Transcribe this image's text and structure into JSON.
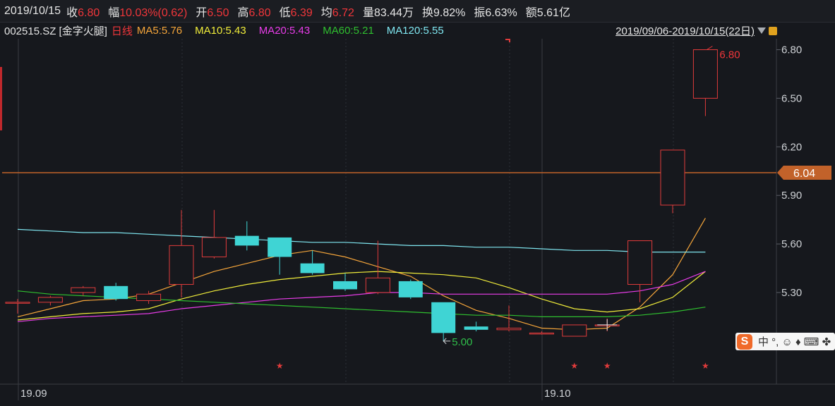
{
  "header": {
    "date": "2019/10/15",
    "fields": [
      {
        "label": "收",
        "value": "6.80",
        "color": "#f0363a"
      },
      {
        "label": "幅",
        "value": "10.03%(0.62)",
        "color": "#f0363a"
      },
      {
        "label": "开",
        "value": "6.50",
        "color": "#f0363a"
      },
      {
        "label": "高",
        "value": "6.80",
        "color": "#f0363a"
      },
      {
        "label": "低",
        "value": "6.39",
        "color": "#f0363a"
      },
      {
        "label": "均",
        "value": "6.72",
        "color": "#f0363a"
      },
      {
        "label": "量",
        "value": "83.44万",
        "color": "#e6e6e6"
      },
      {
        "label": "换",
        "value": "9.82%",
        "color": "#e6e6e6"
      },
      {
        "label": "振",
        "value": "6.63%",
        "color": "#e6e6e6"
      },
      {
        "label": "额",
        "value": "5.61亿",
        "color": "#e6e6e6"
      }
    ]
  },
  "legend": {
    "code": "002515.SZ [金字火腿]",
    "period": "日线",
    "items": [
      {
        "text": "MA5:5.76",
        "color": "#f5a53a"
      },
      {
        "text": "MA10:5.43",
        "color": "#f0ec3a"
      },
      {
        "text": "MA20:5.43",
        "color": "#e83ce8"
      },
      {
        "text": "MA60:5.21",
        "color": "#2fbf2f"
      },
      {
        "text": "MA120:5.55",
        "color": "#7fe6f0"
      }
    ],
    "range": "2019/09/06-2019/10/15(22日)"
  },
  "ime": {
    "logo": "S",
    "text": "中 °, ☺ ♦ ⌨ ✤"
  },
  "chart_data": {
    "type": "candlestick",
    "ylim": [
      4.78,
      6.92
    ],
    "y_ticks": [
      "6.80",
      "6.50",
      "6.20",
      "5.90",
      "5.60",
      "5.30"
    ],
    "x_ticks": [
      {
        "label": "19.09",
        "index": 0
      },
      {
        "label": "19.10",
        "index": 16
      }
    ],
    "crosshair_price": "6.04",
    "high_label": "6.80",
    "low_label": "5.00",
    "up_color": "#e03b3b",
    "down_color": "#3fd4d4",
    "candles": [
      {
        "o": 5.24,
        "c": 5.24,
        "h": 5.26,
        "l": 5.17
      },
      {
        "o": 5.24,
        "c": 5.27,
        "h": 5.28,
        "l": 5.22
      },
      {
        "o": 5.3,
        "c": 5.33,
        "h": 5.34,
        "l": 5.28
      },
      {
        "o": 5.34,
        "c": 5.26,
        "h": 5.36,
        "l": 5.25
      },
      {
        "o": 5.25,
        "c": 5.29,
        "h": 5.31,
        "l": 5.23
      },
      {
        "o": 5.35,
        "c": 5.59,
        "h": 5.81,
        "l": 5.27
      },
      {
        "o": 5.52,
        "c": 5.64,
        "h": 5.81,
        "l": 5.51
      },
      {
        "o": 5.65,
        "c": 5.59,
        "h": 5.74,
        "l": 5.56
      },
      {
        "o": 5.64,
        "c": 5.52,
        "h": 5.64,
        "l": 5.41
      },
      {
        "o": 5.48,
        "c": 5.42,
        "h": 5.56,
        "l": 5.41
      },
      {
        "o": 5.37,
        "c": 5.32,
        "h": 5.42,
        "l": 5.31
      },
      {
        "o": 5.3,
        "c": 5.39,
        "h": 5.62,
        "l": 5.29
      },
      {
        "o": 5.37,
        "c": 5.27,
        "h": 5.38,
        "l": 5.26
      },
      {
        "o": 5.24,
        "c": 5.05,
        "h": 5.24,
        "l": 5.0
      },
      {
        "o": 5.09,
        "c": 5.07,
        "h": 5.12,
        "l": 5.06
      },
      {
        "o": 5.07,
        "c": 5.08,
        "h": 5.22,
        "l": 5.06
      },
      {
        "o": 5.05,
        "c": 5.05,
        "h": 5.06,
        "l": 5.04
      },
      {
        "o": 5.03,
        "c": 5.1,
        "h": 5.1,
        "l": 5.03
      },
      {
        "o": 5.1,
        "c": 5.1,
        "h": 5.14,
        "l": 5.06
      },
      {
        "o": 5.35,
        "c": 5.62,
        "h": 5.62,
        "l": 5.24
      },
      {
        "o": 5.84,
        "c": 6.18,
        "h": 6.18,
        "l": 5.79
      },
      {
        "o": 6.5,
        "c": 6.8,
        "h": 6.8,
        "l": 6.39
      }
    ],
    "series": [
      {
        "name": "MA5",
        "color": "#f5a53a",
        "values": [
          5.15,
          5.2,
          5.25,
          5.26,
          5.29,
          5.36,
          5.43,
          5.48,
          5.53,
          5.56,
          5.52,
          5.46,
          5.4,
          5.28,
          5.19,
          5.14,
          5.08,
          5.07,
          5.08,
          5.21,
          5.41,
          5.76
        ]
      },
      {
        "name": "MA10",
        "color": "#f0ec3a",
        "values": [
          5.13,
          5.15,
          5.17,
          5.18,
          5.2,
          5.26,
          5.31,
          5.35,
          5.38,
          5.4,
          5.42,
          5.43,
          5.42,
          5.41,
          5.39,
          5.33,
          5.26,
          5.2,
          5.18,
          5.2,
          5.27,
          5.43
        ]
      },
      {
        "name": "MA20",
        "color": "#e83ce8",
        "values": [
          5.12,
          5.14,
          5.15,
          5.16,
          5.17,
          5.2,
          5.22,
          5.24,
          5.26,
          5.27,
          5.28,
          5.3,
          5.3,
          5.29,
          5.29,
          5.29,
          5.29,
          5.29,
          5.29,
          5.31,
          5.35,
          5.43
        ]
      },
      {
        "name": "MA60",
        "color": "#2fbf2f",
        "values": [
          5.31,
          5.29,
          5.28,
          5.27,
          5.26,
          5.25,
          5.24,
          5.23,
          5.22,
          5.21,
          5.2,
          5.19,
          5.18,
          5.17,
          5.16,
          5.16,
          5.15,
          5.15,
          5.15,
          5.16,
          5.18,
          5.21
        ]
      },
      {
        "name": "MA120",
        "color": "#7fe6f0",
        "values": [
          5.69,
          5.68,
          5.67,
          5.67,
          5.66,
          5.65,
          5.64,
          5.63,
          5.62,
          5.61,
          5.61,
          5.6,
          5.59,
          5.59,
          5.58,
          5.58,
          5.57,
          5.56,
          5.56,
          5.55,
          5.55,
          5.55
        ]
      }
    ],
    "markers": [
      8,
      17,
      18,
      21
    ]
  }
}
